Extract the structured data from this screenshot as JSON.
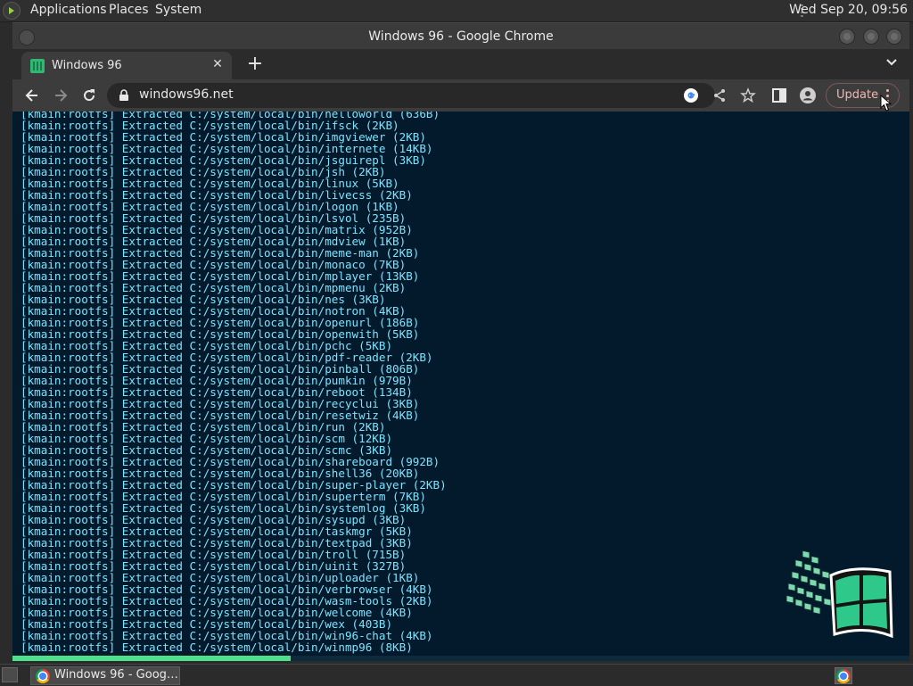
{
  "top_panel": {
    "menus": [
      "Applications",
      "Places",
      "System"
    ],
    "clock": "Wed Sep 20, 09:56"
  },
  "window": {
    "title": "Windows 96 - Google Chrome"
  },
  "tabs": [
    {
      "title": "Windows 96",
      "close": "✕"
    }
  ],
  "toolbar": {
    "new_tab": "+",
    "url": "windows96.net",
    "update_label": "Update"
  },
  "content": {
    "prefix": "[kmain:rootfs] Extracted C:/system/local/bin/",
    "lines": [
      "helloworld (636B)",
      "ifsck (2KB)",
      "imgviewer (2KB)",
      "internete (14KB)",
      "jsguirepl (3KB)",
      "jsh (2KB)",
      "linux (5KB)",
      "livecss (2KB)",
      "logon (1KB)",
      "lsvol (235B)",
      "matrix (952B)",
      "mdview (1KB)",
      "meme-man (2KB)",
      "monaco (7KB)",
      "mplayer (13KB)",
      "mpmenu (2KB)",
      "nes (3KB)",
      "notron (4KB)",
      "openurl (186B)",
      "openwith (5KB)",
      "pchc (5KB)",
      "pdf-reader (2KB)",
      "pinball (806B)",
      "pumkin (979B)",
      "reboot (134B)",
      "recyclui (3KB)",
      "resetwiz (4KB)",
      "run (2KB)",
      "scm (12KB)",
      "scmc (3KB)",
      "shareboard (992B)",
      "shell36 (20KB)",
      "super-player (2KB)",
      "superterm (7KB)",
      "systemlog (3KB)",
      "sysupd (3KB)",
      "taskmgr (5KB)",
      "textpad (3KB)",
      "troll (715B)",
      "uinit (327B)",
      "uploader (1KB)",
      "verbrowser (4KB)",
      "wasm-tools (2KB)",
      "welcome (4KB)",
      "wex (403B)",
      "win96-chat (4KB)",
      "winmp96 (8KB)"
    ],
    "progress_fraction": 0.31
  },
  "taskbar": {
    "task_label": "Windows 96 - Goog…"
  },
  "colors": {
    "terminal_bg": "#03192c",
    "terminal_text": "#7ce4ff",
    "progress": "#4fe08b",
    "update_accent": "#f0b8b0"
  }
}
